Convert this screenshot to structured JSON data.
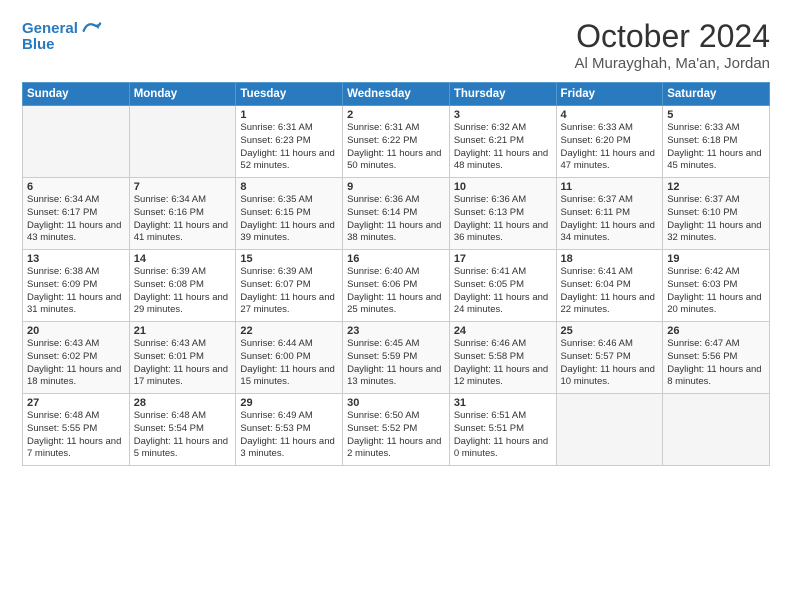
{
  "logo": {
    "line1": "General",
    "line2": "Blue"
  },
  "title": "October 2024",
  "location": "Al Murayghah, Ma'an, Jordan",
  "days_header": [
    "Sunday",
    "Monday",
    "Tuesday",
    "Wednesday",
    "Thursday",
    "Friday",
    "Saturday"
  ],
  "weeks": [
    [
      {
        "day": "",
        "empty": true
      },
      {
        "day": "",
        "empty": true
      },
      {
        "day": "1",
        "sunrise": "6:31 AM",
        "sunset": "6:23 PM",
        "daylight": "Daylight: 11 hours and 52 minutes."
      },
      {
        "day": "2",
        "sunrise": "6:31 AM",
        "sunset": "6:22 PM",
        "daylight": "Daylight: 11 hours and 50 minutes."
      },
      {
        "day": "3",
        "sunrise": "6:32 AM",
        "sunset": "6:21 PM",
        "daylight": "Daylight: 11 hours and 48 minutes."
      },
      {
        "day": "4",
        "sunrise": "6:33 AM",
        "sunset": "6:20 PM",
        "daylight": "Daylight: 11 hours and 47 minutes."
      },
      {
        "day": "5",
        "sunrise": "6:33 AM",
        "sunset": "6:18 PM",
        "daylight": "Daylight: 11 hours and 45 minutes."
      }
    ],
    [
      {
        "day": "6",
        "sunrise": "6:34 AM",
        "sunset": "6:17 PM",
        "daylight": "Daylight: 11 hours and 43 minutes."
      },
      {
        "day": "7",
        "sunrise": "6:34 AM",
        "sunset": "6:16 PM",
        "daylight": "Daylight: 11 hours and 41 minutes."
      },
      {
        "day": "8",
        "sunrise": "6:35 AM",
        "sunset": "6:15 PM",
        "daylight": "Daylight: 11 hours and 39 minutes."
      },
      {
        "day": "9",
        "sunrise": "6:36 AM",
        "sunset": "6:14 PM",
        "daylight": "Daylight: 11 hours and 38 minutes."
      },
      {
        "day": "10",
        "sunrise": "6:36 AM",
        "sunset": "6:13 PM",
        "daylight": "Daylight: 11 hours and 36 minutes."
      },
      {
        "day": "11",
        "sunrise": "6:37 AM",
        "sunset": "6:11 PM",
        "daylight": "Daylight: 11 hours and 34 minutes."
      },
      {
        "day": "12",
        "sunrise": "6:37 AM",
        "sunset": "6:10 PM",
        "daylight": "Daylight: 11 hours and 32 minutes."
      }
    ],
    [
      {
        "day": "13",
        "sunrise": "6:38 AM",
        "sunset": "6:09 PM",
        "daylight": "Daylight: 11 hours and 31 minutes."
      },
      {
        "day": "14",
        "sunrise": "6:39 AM",
        "sunset": "6:08 PM",
        "daylight": "Daylight: 11 hours and 29 minutes."
      },
      {
        "day": "15",
        "sunrise": "6:39 AM",
        "sunset": "6:07 PM",
        "daylight": "Daylight: 11 hours and 27 minutes."
      },
      {
        "day": "16",
        "sunrise": "6:40 AM",
        "sunset": "6:06 PM",
        "daylight": "Daylight: 11 hours and 25 minutes."
      },
      {
        "day": "17",
        "sunrise": "6:41 AM",
        "sunset": "6:05 PM",
        "daylight": "Daylight: 11 hours and 24 minutes."
      },
      {
        "day": "18",
        "sunrise": "6:41 AM",
        "sunset": "6:04 PM",
        "daylight": "Daylight: 11 hours and 22 minutes."
      },
      {
        "day": "19",
        "sunrise": "6:42 AM",
        "sunset": "6:03 PM",
        "daylight": "Daylight: 11 hours and 20 minutes."
      }
    ],
    [
      {
        "day": "20",
        "sunrise": "6:43 AM",
        "sunset": "6:02 PM",
        "daylight": "Daylight: 11 hours and 18 minutes."
      },
      {
        "day": "21",
        "sunrise": "6:43 AM",
        "sunset": "6:01 PM",
        "daylight": "Daylight: 11 hours and 17 minutes."
      },
      {
        "day": "22",
        "sunrise": "6:44 AM",
        "sunset": "6:00 PM",
        "daylight": "Daylight: 11 hours and 15 minutes."
      },
      {
        "day": "23",
        "sunrise": "6:45 AM",
        "sunset": "5:59 PM",
        "daylight": "Daylight: 11 hours and 13 minutes."
      },
      {
        "day": "24",
        "sunrise": "6:46 AM",
        "sunset": "5:58 PM",
        "daylight": "Daylight: 11 hours and 12 minutes."
      },
      {
        "day": "25",
        "sunrise": "6:46 AM",
        "sunset": "5:57 PM",
        "daylight": "Daylight: 11 hours and 10 minutes."
      },
      {
        "day": "26",
        "sunrise": "6:47 AM",
        "sunset": "5:56 PM",
        "daylight": "Daylight: 11 hours and 8 minutes."
      }
    ],
    [
      {
        "day": "27",
        "sunrise": "6:48 AM",
        "sunset": "5:55 PM",
        "daylight": "Daylight: 11 hours and 7 minutes."
      },
      {
        "day": "28",
        "sunrise": "6:48 AM",
        "sunset": "5:54 PM",
        "daylight": "Daylight: 11 hours and 5 minutes."
      },
      {
        "day": "29",
        "sunrise": "6:49 AM",
        "sunset": "5:53 PM",
        "daylight": "Daylight: 11 hours and 3 minutes."
      },
      {
        "day": "30",
        "sunrise": "6:50 AM",
        "sunset": "5:52 PM",
        "daylight": "Daylight: 11 hours and 2 minutes."
      },
      {
        "day": "31",
        "sunrise": "6:51 AM",
        "sunset": "5:51 PM",
        "daylight": "Daylight: 11 hours and 0 minutes."
      },
      {
        "day": "",
        "empty": true
      },
      {
        "day": "",
        "empty": true
      }
    ]
  ]
}
